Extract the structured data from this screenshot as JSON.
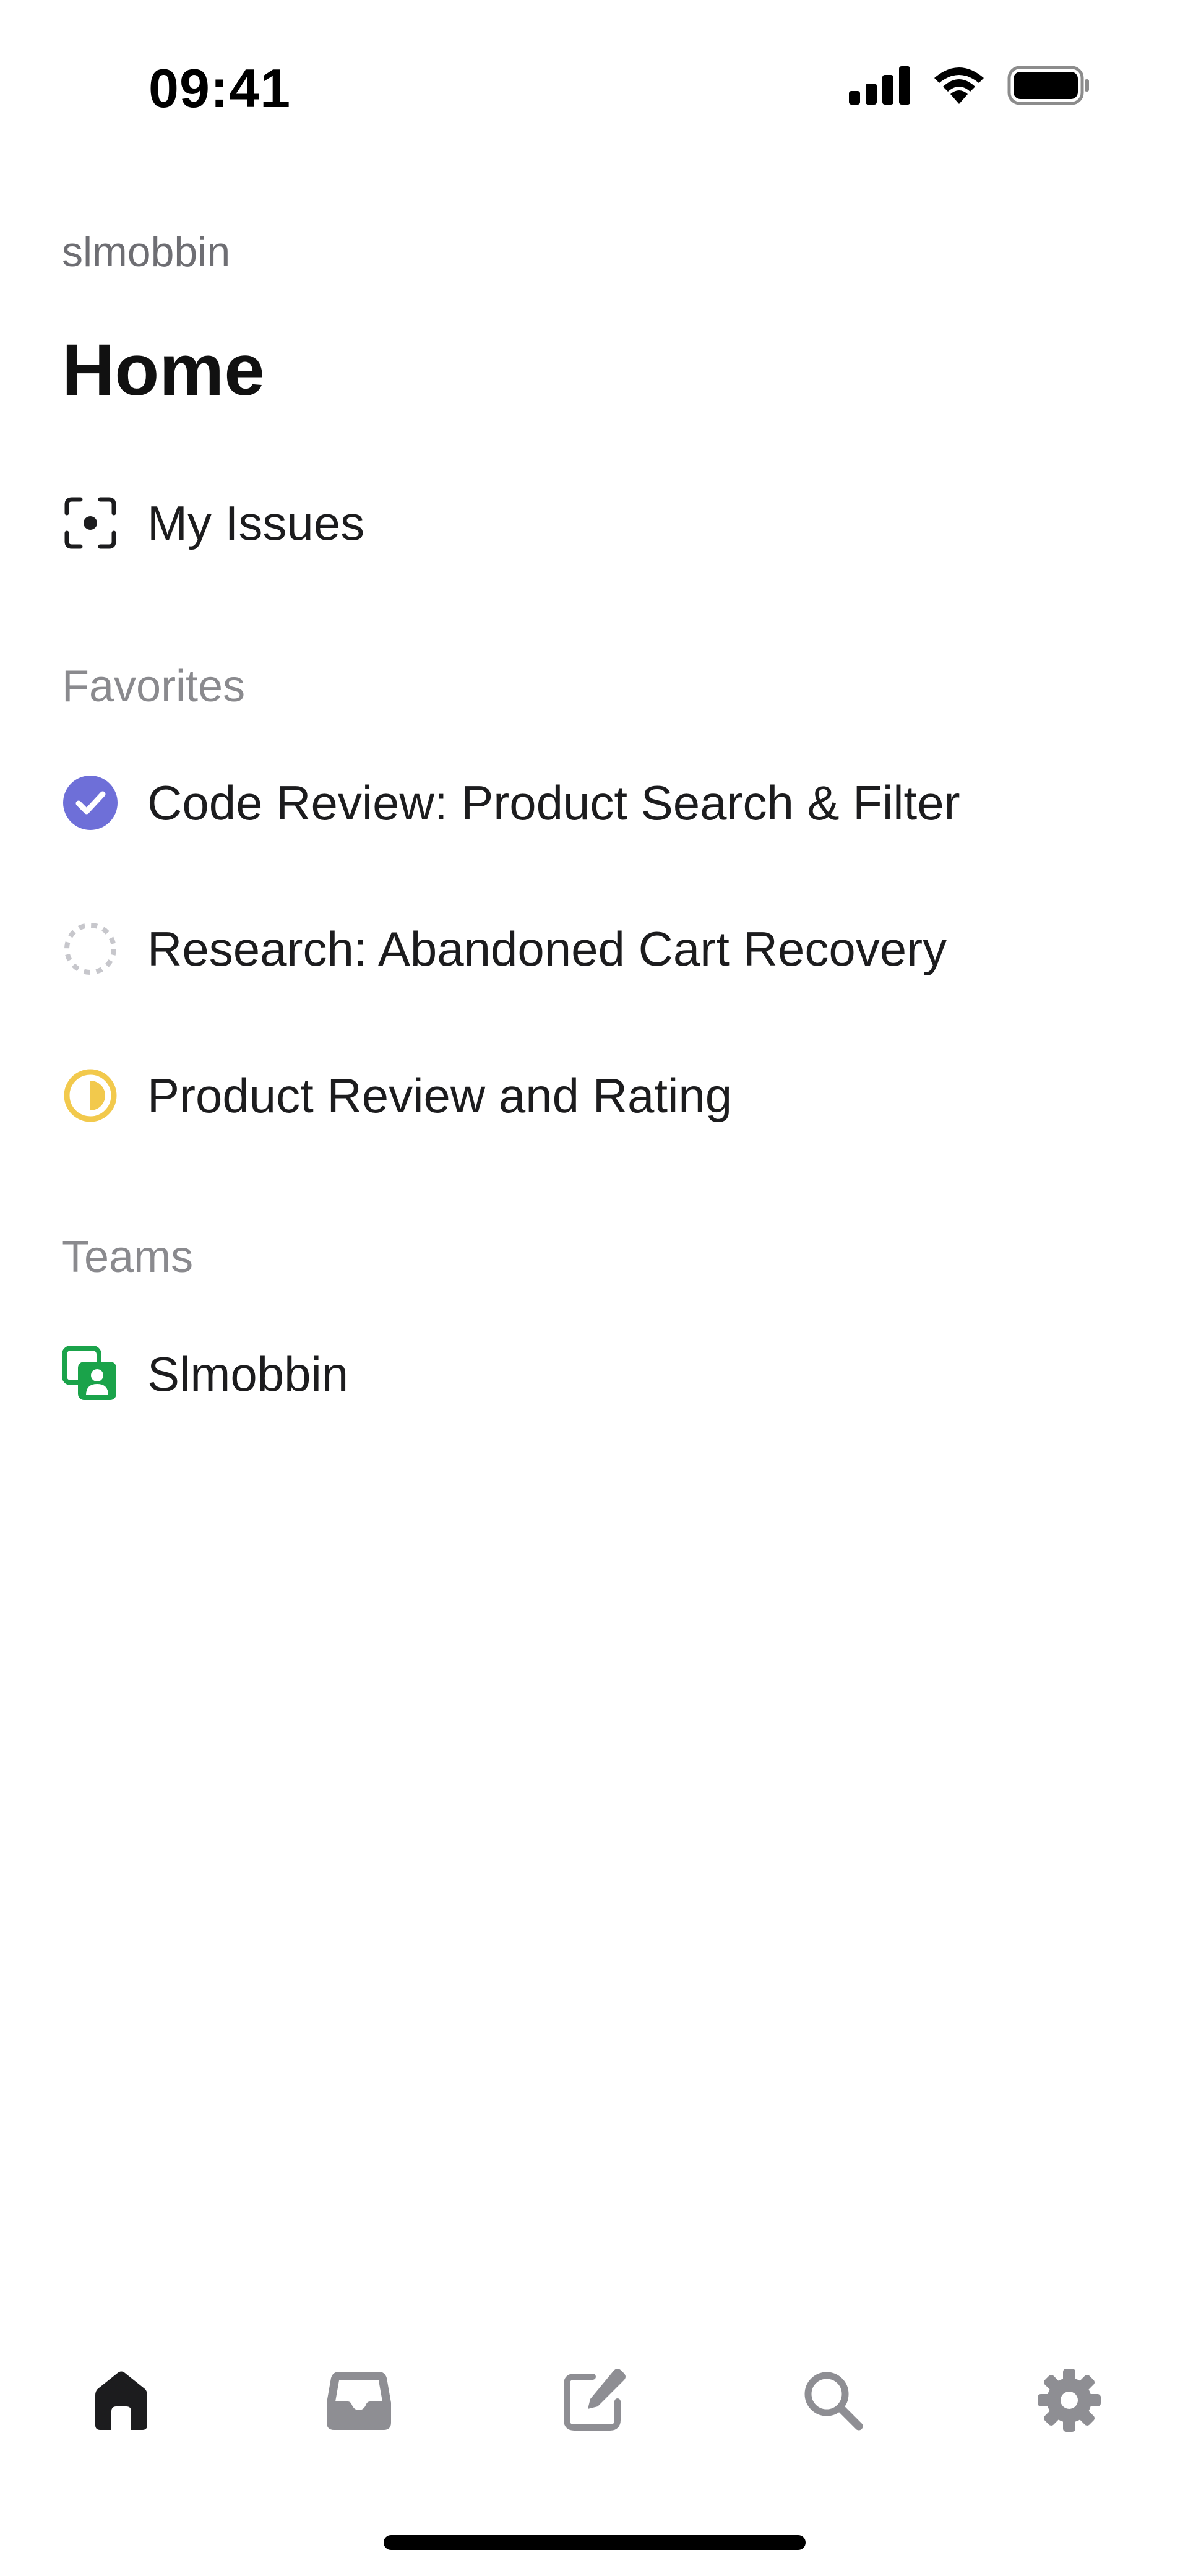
{
  "status_bar": {
    "time": "09:41",
    "icons": [
      "cellular-signal-icon",
      "wifi-icon",
      "battery-icon"
    ]
  },
  "header": {
    "workspace": "slmobbin",
    "title": "Home"
  },
  "my_issues": {
    "label": "My Issues",
    "icon": "focus-target-icon"
  },
  "favorites": {
    "title": "Favorites",
    "items": [
      {
        "label": "Code Review: Product Search & Filter",
        "icon": "status-done-icon",
        "color": "#6e6fd8"
      },
      {
        "label": "Research: Abandoned Cart Recovery",
        "icon": "status-backlog-icon",
        "color": "#c7c7cc"
      },
      {
        "label": "Product Review and Rating",
        "icon": "status-in-progress-icon",
        "color": "#f2c94c"
      }
    ]
  },
  "teams": {
    "title": "Teams",
    "items": [
      {
        "label": "Slmobbin",
        "icon": "team-icon",
        "color": "#1aa34a"
      }
    ]
  },
  "tab_bar": {
    "tabs": [
      {
        "name": "home",
        "icon": "home-icon",
        "active": true
      },
      {
        "name": "inbox",
        "icon": "inbox-icon",
        "active": false
      },
      {
        "name": "compose",
        "icon": "compose-icon",
        "active": false
      },
      {
        "name": "search",
        "icon": "search-icon",
        "active": false
      },
      {
        "name": "settings",
        "icon": "gear-icon",
        "active": false
      }
    ],
    "active_color": "#1c1c1e",
    "inactive_color": "#8e8e93"
  }
}
